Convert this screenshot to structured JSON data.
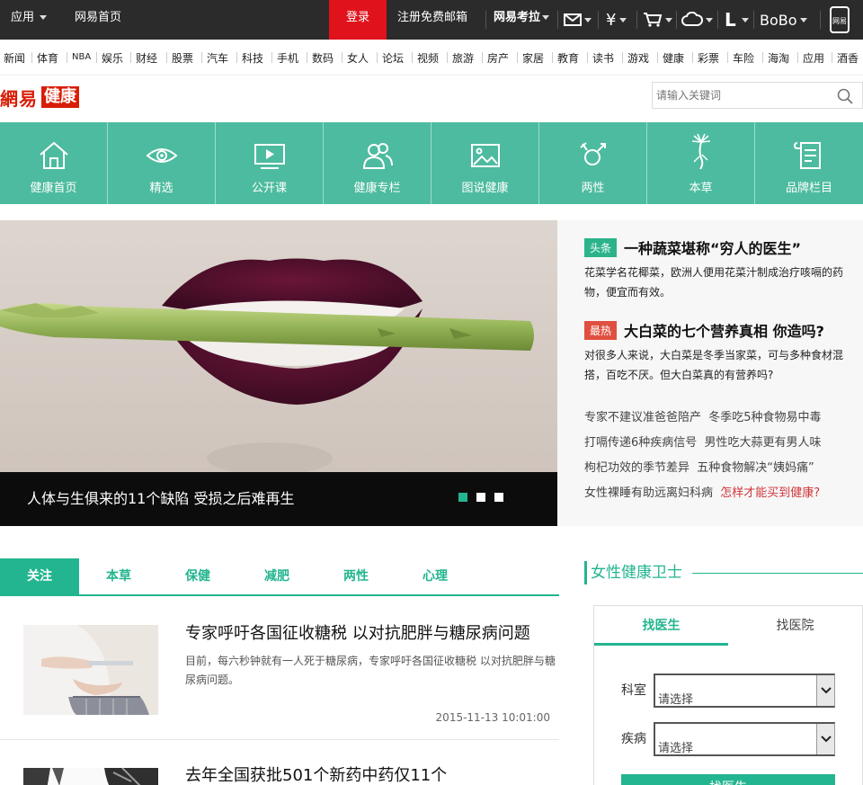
{
  "topbar": {
    "apps_label": "应用",
    "home_label": "网易首页",
    "login_label": "登录",
    "register_label": "注册免费邮箱",
    "kaola_label": "网易考拉",
    "bobo_label": "BoBo",
    "mobile_label": "网易"
  },
  "channels": [
    "新闻",
    "体育",
    "NBA",
    "娱乐",
    "财经",
    "股票",
    "汽车",
    "科技",
    "手机",
    "数码",
    "女人",
    "论坛",
    "视频",
    "旅游",
    "房产",
    "家居",
    "教育",
    "读书",
    "游戏",
    "健康",
    "彩票",
    "车险",
    "海淘",
    "应用",
    "酒香"
  ],
  "logo": {
    "brand": "網易",
    "section": "健康"
  },
  "search": {
    "placeholder": "请输入关键词"
  },
  "green_nav": [
    {
      "label": "健康首页",
      "icon": "home-icon"
    },
    {
      "label": "精选",
      "icon": "eye-icon"
    },
    {
      "label": "公开课",
      "icon": "video-icon"
    },
    {
      "label": "健康专栏",
      "icon": "people-icon"
    },
    {
      "label": "图说健康",
      "icon": "picture-icon"
    },
    {
      "label": "两性",
      "icon": "gender-icon"
    },
    {
      "label": "本草",
      "icon": "herb-icon"
    },
    {
      "label": "品牌栏目",
      "icon": "scroll-icon"
    }
  ],
  "hero": {
    "caption": "人体与生俱来的11个缺陷  受损之后难再生"
  },
  "headlines": [
    {
      "tag": "头条",
      "title": "一种蔬菜堪称“穷人的医生”",
      "desc": "花菜学名花椰菜，欧洲人便用花菜汁制成治疗咳嗝的药物，便宜而有效。"
    },
    {
      "tag": "最热",
      "title": "大白菜的七个营养真相  你造吗?",
      "desc": "对很多人来说，大白菜是冬季当家菜，可与多种食材混搭，百吃不厌。但大白菜真的有营养吗?"
    }
  ],
  "links": [
    [
      "专家不建议准爸爸陪产",
      "冬季吃5种食物易中毒"
    ],
    [
      "打嗝传递6种疾病信号",
      "男性吃大蒜更有男人味"
    ],
    [
      "枸杞功效的季节差异",
      "五种食物解决“姨妈痛”"
    ],
    [
      "女性裸睡有助远离妇科病",
      "怎样才能买到健康?"
    ]
  ],
  "tabs": [
    "关注",
    "本草",
    "保健",
    "减肥",
    "两性",
    "心理"
  ],
  "articles": [
    {
      "title": "专家呼吁各国征收糖税 以对抗肥胖与糖尿病问题",
      "desc": "目前，每六秒钟就有一人死于糖尿病，专家呼吁各国征收糖税 以对抗肥胖与糖尿病问题。",
      "date": "2015-11-13 10:01:00"
    },
    {
      "title": "去年全国获批501个新药中药仅11个"
    }
  ],
  "sidebar": {
    "title": "女性健康卫士",
    "tab_doctor": "找医生",
    "tab_hospital": "找医院",
    "dept_label": "科室",
    "disease_label": "疾病",
    "select_placeholder": "请选择",
    "find_button": "找医生"
  },
  "colors": {
    "accent": "#23b58f",
    "brand_red": "#d81e06",
    "topbar_bg": "#2b2b2b"
  }
}
